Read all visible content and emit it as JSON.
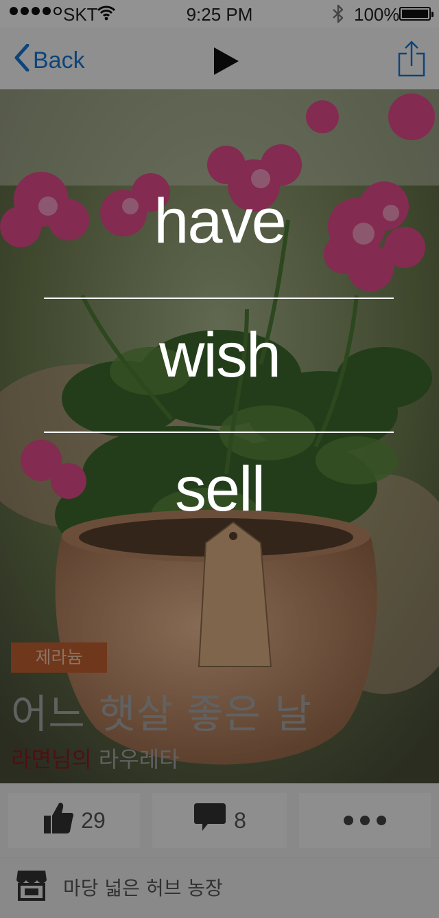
{
  "status_bar": {
    "carrier": "SKT",
    "time": "9:25 PM",
    "battery": "100%",
    "battery_level": 1.0,
    "signal_bars": 4
  },
  "nav": {
    "back_label": "Back",
    "back_color": "#1976d2"
  },
  "post": {
    "category": "제라늄",
    "title": "어느 햇살 좋은 날",
    "author": "라면님의",
    "farm": "라우레타",
    "tag_color": "#c0602f"
  },
  "actions": {
    "likes": "29",
    "comments": "8"
  },
  "shop": {
    "name": "마당 넓은 허브 농장"
  },
  "overlay_menu": {
    "options": [
      "have",
      "wish",
      "sell"
    ]
  }
}
